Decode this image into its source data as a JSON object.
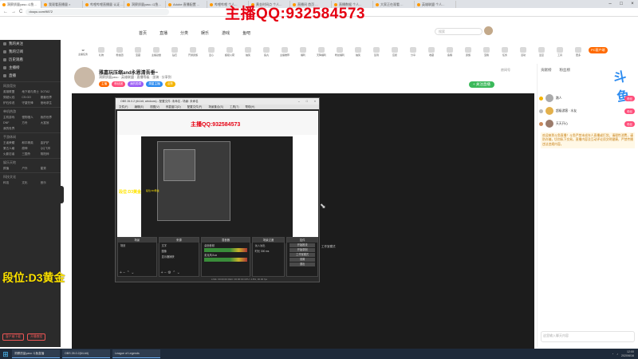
{
  "watermark": "主播QQ:932584573",
  "browser": {
    "tabs": [
      {
        "title": "洞察质量yasu 斗鱼..."
      },
      {
        "title": "我观看直播量 ×"
      },
      {
        "title": "哔哩哔哩直播量 认证 ..."
      },
      {
        "title": "洞察质量yasu 斗鱼..."
      },
      {
        "title": "Adobe 直播配置 ..."
      },
      {
        "title": "哔哩哔哩 个人..."
      },
      {
        "title": "黄金时间点 个人..."
      },
      {
        "title": "直播间 首页 ..."
      },
      {
        "title": "直播数据 个人..."
      },
      {
        "title": "大家正在观看 ..."
      },
      {
        "title": "英雄联盟 个人..."
      }
    ],
    "url": "douyu.com/9872",
    "nav_back": "←",
    "nav_forward": "→",
    "nav_reload": "C"
  },
  "site": {
    "logo": "斗鱼",
    "nav": [
      "首页",
      "直播",
      "分类",
      "娱乐",
      "游戏",
      "鱼吧"
    ],
    "search_placeholder": "搜索"
  },
  "gifts_bar": {
    "count": "12",
    "items": [
      "主播任务",
      "礼物",
      "粉丝团",
      "宝藏",
      "主播勋章",
      "钻石",
      "开通贵族",
      "爱心",
      "超级火箭",
      "抽奖",
      "鱼丸",
      "主播推荐",
      "福利",
      "天降福利",
      "粉丝福利",
      "抽奖",
      "签到",
      "应援",
      "分享",
      "收藏",
      "鱼粮",
      "贵族",
      "宝箱",
      "任务",
      "活动",
      "爱豆",
      "工具",
      "更多"
    ],
    "pc_button": "PC客户端"
  },
  "room": {
    "title": "雅嘉玩压缩and永恩清吾垂~",
    "subtitle": "洞察质量yasu · 英雄联盟 · 直播等级 · 坐骑 · 分享到",
    "tags": [
      "主播",
      "粉丝团",
      "我的勋章",
      "周星主播",
      "点赞"
    ],
    "follow_label": "+ 关注直播",
    "follow_count": "",
    "meta": "房间号"
  },
  "obs": {
    "title": "OBS 26.0.2 (64-bit, windows) - 配置文件: 未命名 - 场景: 未命名",
    "menu": [
      "文件(F)",
      "编辑(E)",
      "视图(V)",
      "停靠窗口(D)",
      "配置文件(P)",
      "场景集合(S)",
      "工具(T)",
      "帮助(H)"
    ],
    "nested_watermark": "主播QQ:932584573",
    "rank_small": "段位:D3黄金",
    "rank_tiny": "段位:D3黄金",
    "docks": {
      "scenes": {
        "header": "场景",
        "items": [
          "场景"
        ]
      },
      "sources": {
        "header": "来源",
        "items": [
          "文字",
          "图像",
          "显示器捕获"
        ]
      },
      "mixer": {
        "header": "混音器",
        "items": [
          "桌面音频",
          "麦克风/Aux"
        ]
      },
      "transitions": {
        "header": "场景过渡",
        "items": [
          "淡入淡出",
          "时长 300 ms"
        ]
      },
      "controls": {
        "header": "控件",
        "items": [
          "开始推流",
          "开始录制",
          "工作室模式",
          "设置",
          "退出"
        ]
      }
    },
    "status": "LIVE: 00:00:00   REC: 00:00:00   CPU: 4.8%, 30.00 fps",
    "right_label": "工作室模式"
  },
  "overlay_rank": "段位:D3黄金",
  "chat": {
    "tabs": [
      "贡献榜",
      "粉丝榜"
    ],
    "big_char": "斗鱼",
    "rank": [
      {
        "name": "路人",
        "badge": "粉丝"
      },
      {
        "name": "超级游客 · 水友",
        "badge": "粉丝"
      },
      {
        "name": "天天开心",
        "badge": "粉丝"
      }
    ],
    "notice": "欢迎来到斗鱼直播！斗鱼严禁未成年人直播或打赏。请理性消费，谨防诈骗，切勿私下交易。直播内容及互动评论须文明健康，严禁传播违法违规内容。",
    "input_placeholder": "这里输入聊天内容"
  },
  "sidebar": {
    "items": [
      "我的关注",
      "我的订阅",
      "历史观看",
      "主播榜",
      "直播"
    ],
    "groups": [
      {
        "label": "网游竞技",
        "items": [
          "英雄联盟",
          "地下城与勇士",
          "DOTA2",
          "穿越火线",
          "CS:GO",
          "魔兽世界",
          "炉石传说",
          "守望先锋",
          "绝地求生"
        ]
      },
      {
        "label": "单机热游",
        "items": [
          "主机游戏",
          "怪物猎人",
          "我的世界",
          "DNF",
          "方舟",
          "大富翁",
          "我的世界"
        ]
      },
      {
        "label": "手游休闲",
        "items": [
          "王者荣耀",
          "和平精英",
          "金铲铲",
          "第五人格",
          "原神",
          "QQ飞车",
          "火影忍者",
          "三国杀",
          "阴阳师"
        ]
      },
      {
        "label": "娱乐天地",
        "items": [
          "颜值",
          "户外",
          "星秀"
        ]
      },
      {
        "label": "科技文化",
        "items": [
          "科技",
          "文化",
          "音乐"
        ]
      }
    ],
    "buttons": [
      "客户端下载",
      "开播教程"
    ]
  },
  "taskbar": {
    "start": "⊞",
    "tasks": [
      "洞察质量yasu 斗鱼直播",
      "OBS 26.0.2(64-bit)",
      "League of Legends"
    ],
    "time": "12:00",
    "date": "2020/6/16"
  }
}
